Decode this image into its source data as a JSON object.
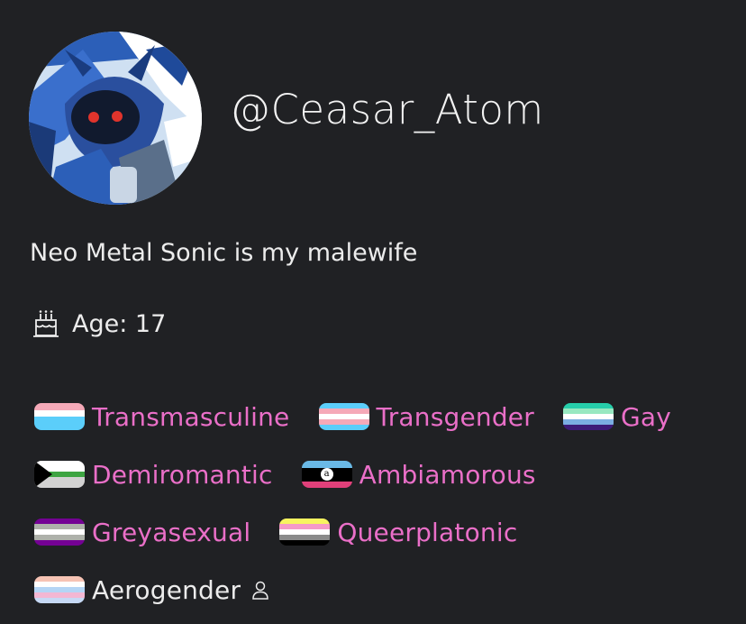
{
  "profile": {
    "username": "@Ceasar_Atom",
    "bio": "Neo Metal Sonic is my malewife",
    "age_text": "Age: 17",
    "avatar_icon": "avatar-image",
    "birthday_icon": "cake-icon"
  },
  "labels": [
    {
      "name": "Transmasculine",
      "flag": [
        "#f5a9b8",
        "#ffffff",
        "#5bcefa",
        "#5bcefa"
      ]
    },
    {
      "name": "Transgender",
      "flag": [
        "#5bcefa",
        "#f5a9b8",
        "#ffffff",
        "#f5a9b8",
        "#5bcefa"
      ]
    },
    {
      "name": "Gay",
      "flag": [
        "#26ceaa",
        "#98e8c1",
        "#ffffff",
        "#7bade2",
        "#3d1a78"
      ]
    },
    {
      "name": "Demiromantic",
      "flag": [
        "#ffffff",
        "#ffffff",
        "#3da542",
        "#d2d2d2",
        "#d2d2d2"
      ]
    },
    {
      "name": "Ambiamorous",
      "flag": [
        "#6ab9e6",
        "#000000",
        "#000000",
        "#e0407a"
      ]
    },
    {
      "name": "Greyasexual",
      "flag": [
        "#740194",
        "#aeb1aa",
        "#ffffff",
        "#aeb1aa",
        "#740194"
      ]
    },
    {
      "name": "Queerplatonic",
      "flag": [
        "#f7f45f",
        "#f59ac7",
        "#ffffff",
        "#8a8a8a",
        "#000000"
      ]
    },
    {
      "name": "Aerogender",
      "flag": [
        "#f6c3b4",
        "#fefefe",
        "#b4d5f5",
        "#f3b7d3",
        "#c6d9f5"
      ]
    }
  ],
  "colors": {
    "background": "#202124",
    "label_accent": "#ea6fc8",
    "text": "#ececec"
  },
  "extra_icon": "person-icon"
}
